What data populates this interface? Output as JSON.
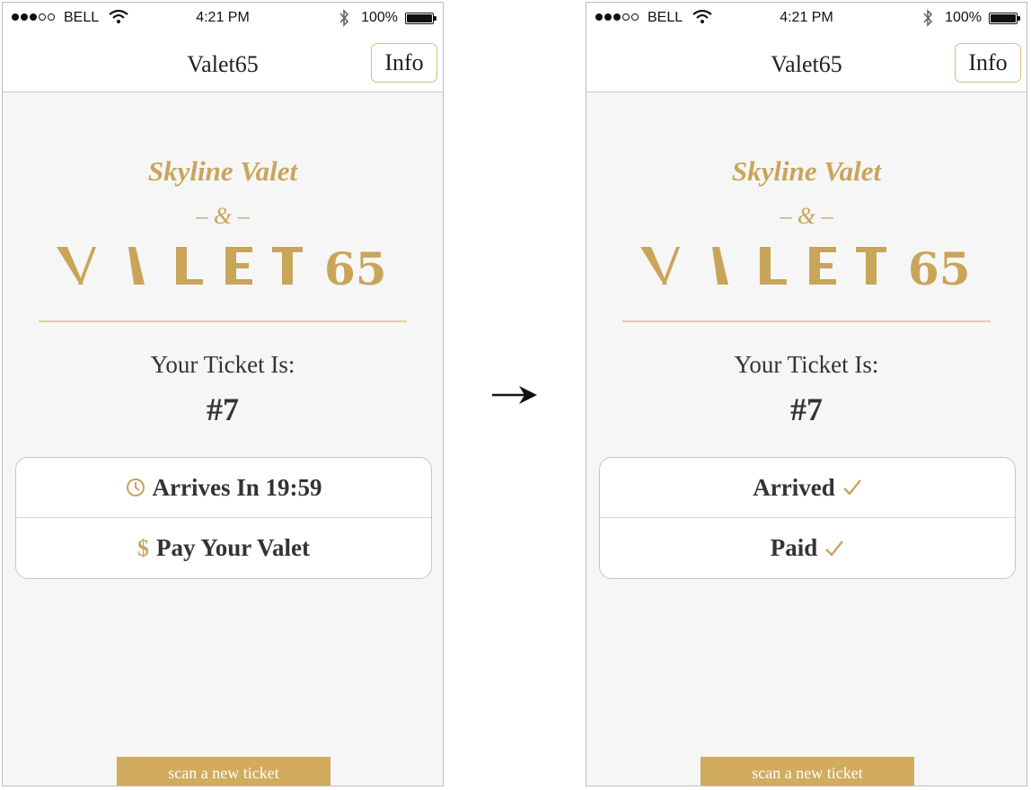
{
  "status_bar": {
    "carrier": "BELL",
    "time": "4:21 PM",
    "battery": "100%"
  },
  "nav": {
    "title": "Valet65",
    "info_label": "Info"
  },
  "branding": {
    "skyline": "Skyline Valet",
    "ampersand": "– & –",
    "logo_text": "VALET65",
    "accent_color": "#c9a55a"
  },
  "ticket": {
    "label": "Your Ticket Is:",
    "number": "#7"
  },
  "screens": {
    "before": {
      "arrival": "Arrives In 19:59",
      "arrival_icon": "clock-icon",
      "payment": "Pay Your Valet",
      "payment_icon": "dollar-icon"
    },
    "after": {
      "arrival": "Arrived",
      "arrival_icon": "check-icon",
      "payment": "Paid",
      "payment_icon": "check-icon"
    }
  },
  "scan_button": "scan a new ticket",
  "transition_icon": "right-arrow-icon"
}
